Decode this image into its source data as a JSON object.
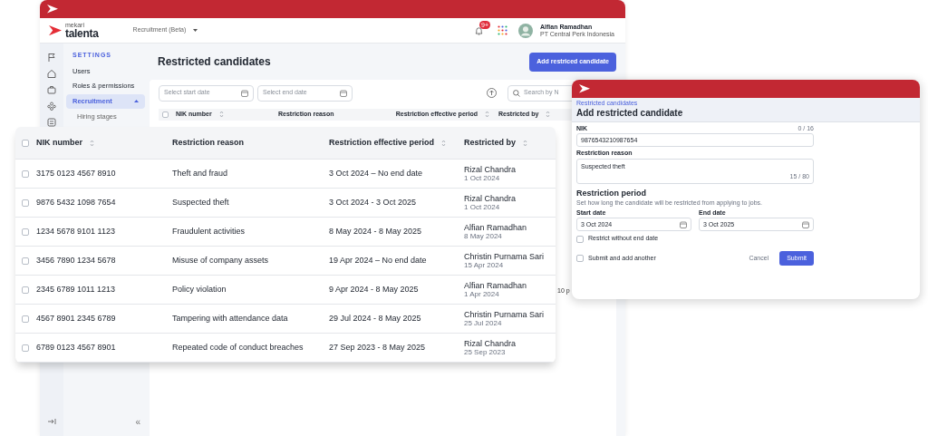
{
  "back_window": {
    "header": {
      "logo_top": "mekari",
      "logo_bottom": "talenta",
      "product": "Recruitment (Beta)",
      "notification_badge": "9+",
      "user_name": "Alfian Ramadhan",
      "user_company": "PT Central Perk Indonesia"
    },
    "sidebar": {
      "section": "SETTINGS",
      "collapse_glyph": "«",
      "items": [
        {
          "label": "Users",
          "selected": false
        },
        {
          "label": "Roles & permissions",
          "selected": false
        },
        {
          "label": "Recruitment",
          "selected": true,
          "expanded": true,
          "children": [
            {
              "label": "Hiring stages",
              "selected": false
            }
          ]
        }
      ]
    },
    "page_title": "Restricted candidates",
    "primary_button": "Add restriced candidate",
    "filters": [
      {
        "placeholder": "Select start date"
      },
      {
        "placeholder": "Select end date"
      }
    ],
    "search": {
      "placeholder": "Search by N"
    },
    "table": {
      "select_all_checked": false,
      "columns": [
        {
          "label": "NIK number",
          "sortable": true
        },
        {
          "label": "Restriction reason",
          "sortable": false
        },
        {
          "label": "Restriction effective period",
          "sortable": true
        },
        {
          "label": "Restricted by",
          "sortable": true
        }
      ]
    },
    "pagination": "10 p"
  },
  "table_card": {
    "select_all_checked": false,
    "columns": [
      {
        "label": "NIK number",
        "sortable": true
      },
      {
        "label": "Restriction reason",
        "sortable": false
      },
      {
        "label": "Restriction effective period",
        "sortable": true
      },
      {
        "label": "Restricted by",
        "sortable": true
      }
    ],
    "rows": [
      {
        "checked": false,
        "nik": "3175 0123 4567 8910",
        "reason": "Theft and fraud",
        "period": "3 Oct 2024 – No end date",
        "restricted_by": "Rizal Chandra",
        "date": "1 Oct 2024"
      },
      {
        "checked": false,
        "nik": "9876 5432 1098 7654",
        "reason": "Suspected theft",
        "period": "3 Oct 2024 - 3 Oct 2025",
        "restricted_by": "Rizal Chandra",
        "date": "1 Oct 2024"
      },
      {
        "checked": false,
        "nik": "1234 5678 9101 1123",
        "reason": "Fraudulent activities",
        "period": "8 May 2024 - 8 May 2025",
        "restricted_by": "Alfian Ramadhan",
        "date": "8 May 2024"
      },
      {
        "checked": false,
        "nik": "3456 7890 1234 5678",
        "reason": "Misuse of company assets",
        "period": "19 Apr 2024 – No end date",
        "restricted_by": "Christin Purnama Sari",
        "date": "15 Apr 2024"
      },
      {
        "checked": false,
        "nik": "2345 6789 1011 1213",
        "reason": "Policy violation",
        "period": "9 Apr 2024 - 8 May 2025",
        "restricted_by": "Alfian Ramadhan",
        "date": "1 Apr 2024"
      },
      {
        "checked": false,
        "nik": "4567 8901 2345 6789",
        "reason": "Tampering with attendance data",
        "period": "29 Jul 2024 - 8 May 2025",
        "restricted_by": "Christin Purnama Sari",
        "date": "25 Jul 2024"
      },
      {
        "checked": false,
        "nik": "6789 0123 4567 8901",
        "reason": "Repeated code of conduct breaches",
        "period": "27 Sep 2023 - 8 May 2025",
        "restricted_by": "Rizal Chandra",
        "date": "25 Sep 2023"
      }
    ]
  },
  "dialog": {
    "breadcrumb": "Restricted candidates",
    "title": "Add restricted candidate",
    "nik": {
      "label": "NIK",
      "counter": "0 / 16",
      "value": "9876543210987654"
    },
    "reason": {
      "label": "Restriction reason",
      "value": "Suspected theft",
      "counter": "15 / 80"
    },
    "period_heading": "Restriction period",
    "period_description": "Set how long the candidate will be restricted from applying to jobs.",
    "start": {
      "label": "Start date",
      "value": "3 Oct 2024"
    },
    "end": {
      "label": "End date",
      "value": "3 Oct 2025"
    },
    "no_end_date": {
      "label": "Restrict without end date",
      "checked": false
    },
    "add_another": {
      "label": "Submit and add another",
      "checked": false
    },
    "cancel": "Cancel",
    "submit": "Submit"
  }
}
